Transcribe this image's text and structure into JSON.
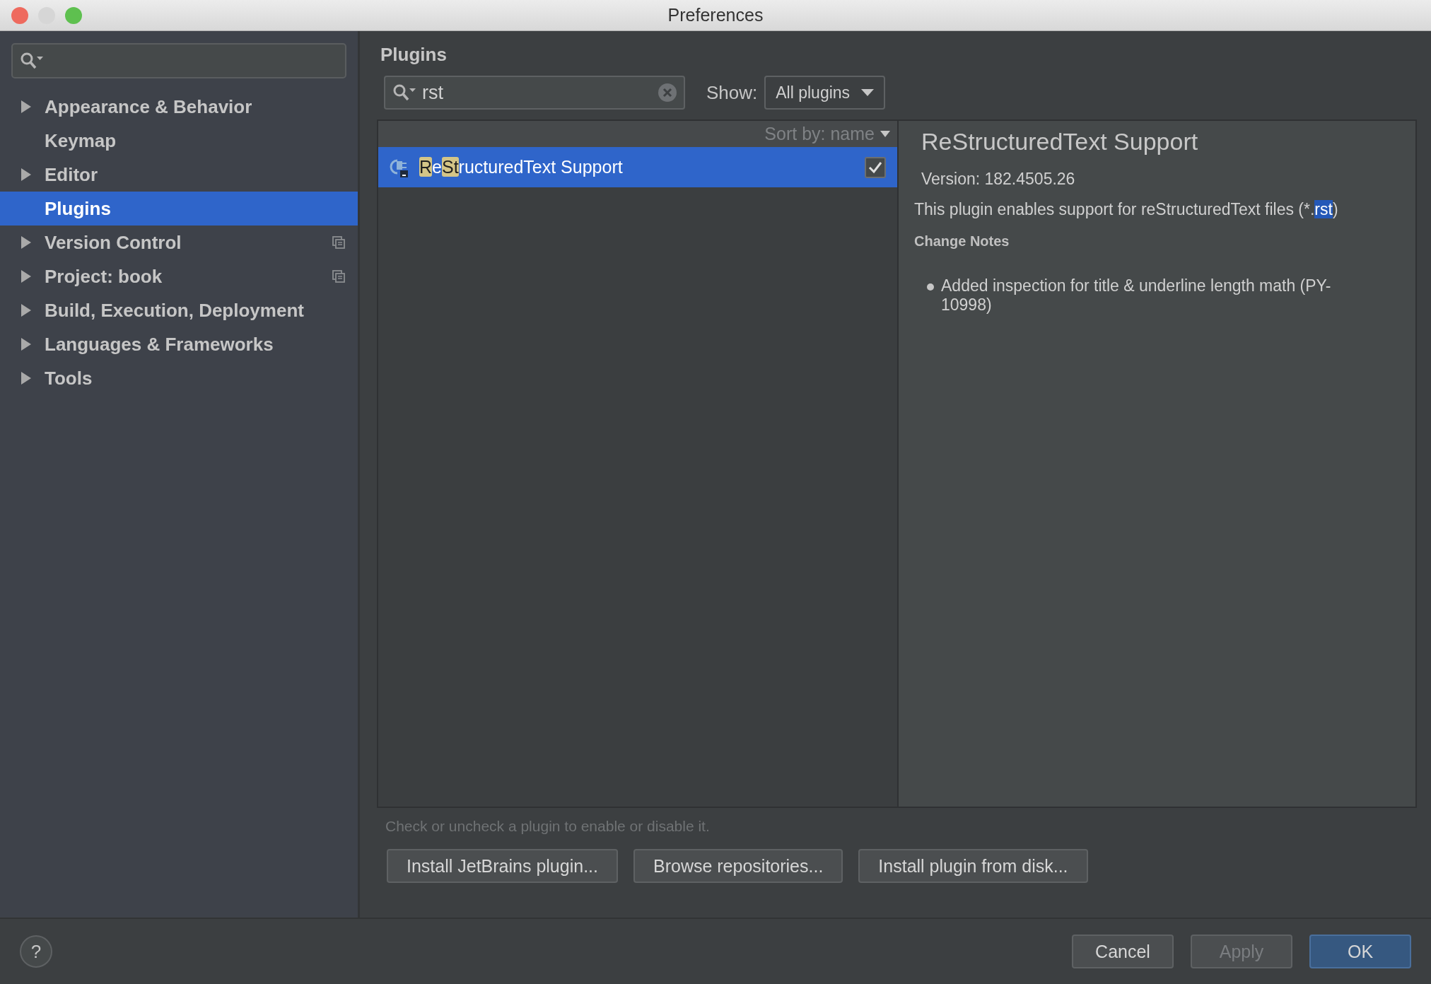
{
  "window": {
    "title": "Preferences"
  },
  "sidebar": {
    "items": [
      {
        "label": "Appearance & Behavior",
        "expandable": true,
        "selected": false,
        "project_scoped": false
      },
      {
        "label": "Keymap",
        "expandable": false,
        "selected": false,
        "project_scoped": false
      },
      {
        "label": "Editor",
        "expandable": true,
        "selected": false,
        "project_scoped": false
      },
      {
        "label": "Plugins",
        "expandable": false,
        "selected": true,
        "project_scoped": false
      },
      {
        "label": "Version Control",
        "expandable": true,
        "selected": false,
        "project_scoped": true
      },
      {
        "label": "Project: book",
        "expandable": true,
        "selected": false,
        "project_scoped": true
      },
      {
        "label": "Build, Execution, Deployment",
        "expandable": true,
        "selected": false,
        "project_scoped": false
      },
      {
        "label": "Languages & Frameworks",
        "expandable": true,
        "selected": false,
        "project_scoped": false
      },
      {
        "label": "Tools",
        "expandable": true,
        "selected": false,
        "project_scoped": false
      }
    ]
  },
  "page_title": "Plugins",
  "search": {
    "value": "rst"
  },
  "show": {
    "label": "Show:",
    "value": "All plugins"
  },
  "list": {
    "sort_label": "Sort by: name",
    "rows": [
      {
        "name_parts": [
          {
            "text": "R",
            "match": true
          },
          {
            "text": "e",
            "match": false
          },
          {
            "text": "St",
            "match": true
          },
          {
            "text": "ructuredText Support",
            "match": false
          }
        ],
        "selected": true,
        "checked": true
      }
    ]
  },
  "detail": {
    "title": "ReStructuredText Support",
    "version": "Version: 182.4505.26",
    "description_parts": [
      {
        "text": "This plugin enables support for reStructuredText files (*.",
        "selected": false
      },
      {
        "text": "rst",
        "selected": true
      },
      {
        "text": ")",
        "selected": false
      }
    ],
    "notes_heading": "Change Notes",
    "notes": [
      "Added inspection for title & underline length math (PY-10998)"
    ]
  },
  "hint": "Check or uncheck a plugin to enable or disable it.",
  "plugin_buttons": [
    "Install JetBrains plugin...",
    "Browse repositories...",
    "Install plugin from disk..."
  ],
  "footer": {
    "help": "?",
    "buttons": [
      {
        "label": "Cancel",
        "kind": "normal"
      },
      {
        "label": "Apply",
        "kind": "disabled"
      },
      {
        "label": "OK",
        "kind": "default"
      }
    ]
  }
}
